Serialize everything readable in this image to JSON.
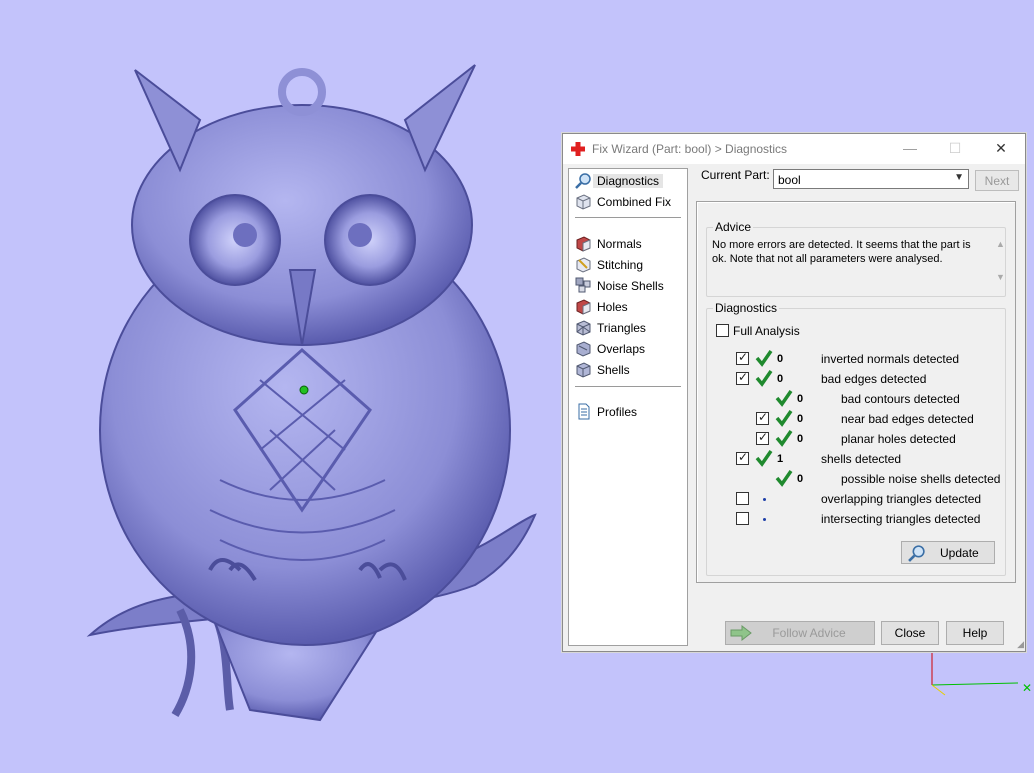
{
  "window": {
    "title": "Fix Wizard (Part: bool) > Diagnostics",
    "minimize": "—",
    "maximize": "☐",
    "close": "✕"
  },
  "nav": {
    "items": [
      {
        "label": "Diagnostics",
        "icon": "magnifier-icon"
      },
      {
        "label": "Combined Fix",
        "icon": "cube-icon"
      },
      {
        "label": "Normals",
        "icon": "normals-cube-icon"
      },
      {
        "label": "Stitching",
        "icon": "stitching-cube-icon"
      },
      {
        "label": "Noise Shells",
        "icon": "noise-shells-icon"
      },
      {
        "label": "Holes",
        "icon": "holes-cube-icon"
      },
      {
        "label": "Triangles",
        "icon": "triangles-cube-icon"
      },
      {
        "label": "Overlaps",
        "icon": "overlaps-icon"
      },
      {
        "label": "Shells",
        "icon": "shells-icon"
      },
      {
        "label": "Profiles",
        "icon": "document-icon"
      }
    ]
  },
  "current_part": {
    "label": "Current Part:",
    "value": "bool",
    "next": "Next"
  },
  "advice": {
    "title": "Advice",
    "text": "No more errors are detected. It seems that the part is ok. Note that not all parameters were analysed."
  },
  "diagnostics": {
    "title": "Diagnostics",
    "full_analysis": "Full Analysis",
    "rows": [
      {
        "checked": true,
        "status": "ok",
        "count": "0",
        "label": "inverted normals detected"
      },
      {
        "checked": true,
        "status": "ok",
        "count": "0",
        "label": "bad edges detected"
      },
      {
        "checked": null,
        "status": "ok",
        "count": "0",
        "label": "bad contours detected"
      },
      {
        "checked": true,
        "status": "ok",
        "count": "0",
        "label": "near bad edges detected"
      },
      {
        "checked": true,
        "status": "ok",
        "count": "0",
        "label": "planar holes detected"
      },
      {
        "checked": true,
        "status": "ok",
        "count": "1",
        "label": "shells detected"
      },
      {
        "checked": null,
        "status": "ok",
        "count": "0",
        "label": "possible noise shells detected"
      },
      {
        "checked": false,
        "status": "pending",
        "count": "",
        "label": "overlapping triangles detected"
      },
      {
        "checked": false,
        "status": "pending",
        "count": "",
        "label": "intersecting triangles detected"
      }
    ],
    "update": "Update"
  },
  "footer": {
    "follow_advice": "Follow Advice",
    "close": "Close",
    "help": "Help"
  },
  "colors": {
    "viewport": "#c3c3fb",
    "model": "#8e90d6",
    "accent_tick": "#1f8a2e",
    "axis_x": "#00c000",
    "axis_z": "#d00000"
  }
}
